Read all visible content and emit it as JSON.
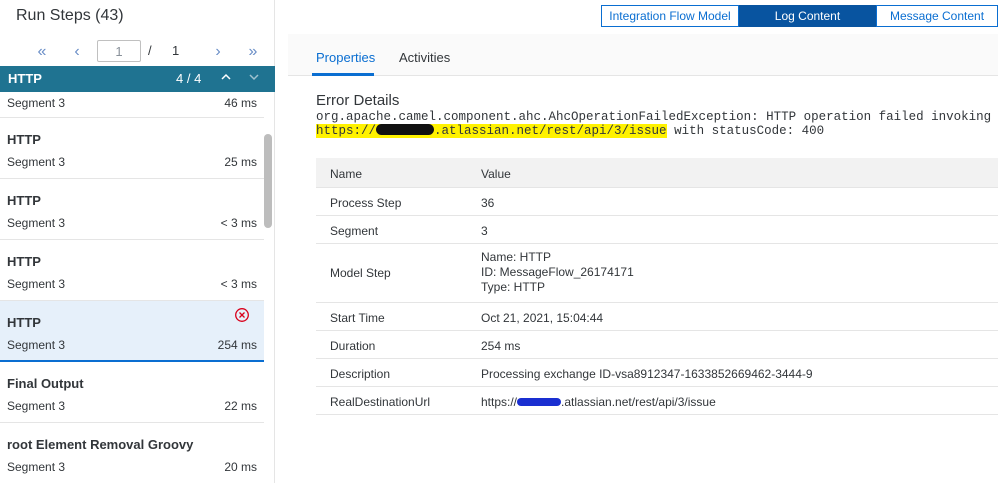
{
  "left_panel": {
    "title": "Run Steps (43)",
    "pager": {
      "first_icon": "double-chevron-left-icon",
      "prev_icon": "chevron-left-icon",
      "current_page": "1",
      "separator": "/",
      "total_pages": "1",
      "next_icon": "chevron-right-icon",
      "last_icon": "double-chevron-right-icon"
    },
    "group": {
      "title": "HTTP",
      "count": "4 / 4"
    },
    "steps": [
      {
        "title": "",
        "segment": "Segment 3",
        "duration": "46 ms"
      },
      {
        "title": "HTTP",
        "segment": "Segment 3",
        "duration": "25 ms"
      },
      {
        "title": "HTTP",
        "segment": "Segment 3",
        "duration": "< 3 ms"
      },
      {
        "title": "HTTP",
        "segment": "Segment 3",
        "duration": "< 3 ms"
      },
      {
        "title": "HTTP",
        "segment": "Segment 3",
        "duration": "254 ms",
        "selected": true,
        "error": true
      },
      {
        "title": "Final Output",
        "segment": "Segment 3",
        "duration": "22 ms"
      },
      {
        "title": "root Element Removal Groovy",
        "segment": "Segment 3",
        "duration": "20 ms"
      }
    ]
  },
  "top_buttons": {
    "integration_flow_model": "Integration Flow Model",
    "log_content": "Log Content",
    "message_content": "Message Content"
  },
  "tabs": {
    "properties": "Properties",
    "activities": "Activities"
  },
  "error_details": {
    "title": "Error Details",
    "line1": "org.apache.camel.component.ahc.AhcOperationFailedException: HTTP operation failed invoking",
    "url_prefix": "https://",
    "url_suffix": ".atlassian.net/rest/api/3/issue",
    "line2_tail": " with statusCode: 400"
  },
  "properties_table": {
    "headers": {
      "name": "Name",
      "value": "Value"
    },
    "rows": {
      "process_step": {
        "name": "Process Step",
        "value": "36"
      },
      "segment": {
        "name": "Segment",
        "value": "3"
      },
      "model_step": {
        "name": "Model Step",
        "value_line1": "Name: HTTP",
        "value_line2": "ID: MessageFlow_26174171",
        "value_line3": "Type: HTTP"
      },
      "start_time": {
        "name": "Start Time",
        "value": "Oct 21, 2021, 15:04:44"
      },
      "duration": {
        "name": "Duration",
        "value": "254 ms"
      },
      "description": {
        "name": "Description",
        "value": "Processing exchange ID-vsa8912347-1633852669462-3444-9"
      },
      "real_destination_url": {
        "name": "RealDestinationUrl",
        "value_prefix": "https://",
        "value_suffix": ".atlassian.net/rest/api/3/issue"
      }
    }
  },
  "colors": {
    "group_header": "#1f7391",
    "accent": "#0a6ed1",
    "active_button": "#0854a0",
    "highlight": "#fff200",
    "error": "#d9001b"
  }
}
